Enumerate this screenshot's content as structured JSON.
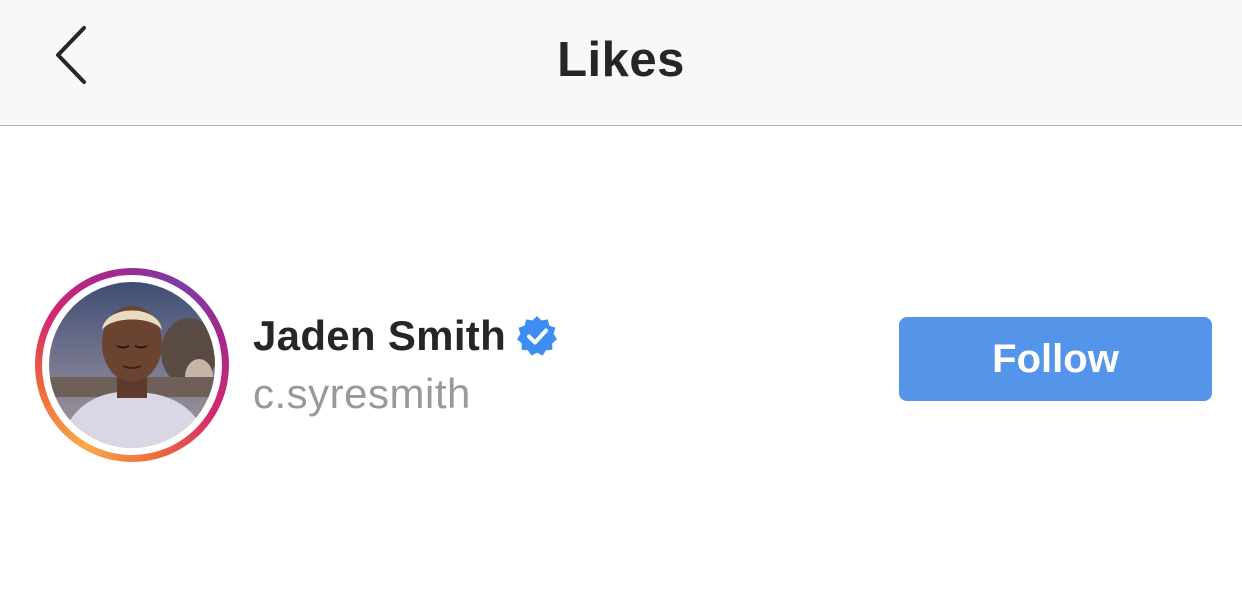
{
  "header": {
    "title": "Likes",
    "back_icon": "chevron-left-icon"
  },
  "likes": [
    {
      "name": "Jaden Smith",
      "handle": "c.syresmith",
      "verified": true,
      "verified_icon": "verified-badge-icon",
      "follow_label": "Follow"
    }
  ],
  "colors": {
    "header_bg": "#f8f8f8",
    "title": "#262626",
    "handle": "#999999",
    "follow_button": "#5595e9",
    "verified_badge": "#3d8ef0"
  }
}
